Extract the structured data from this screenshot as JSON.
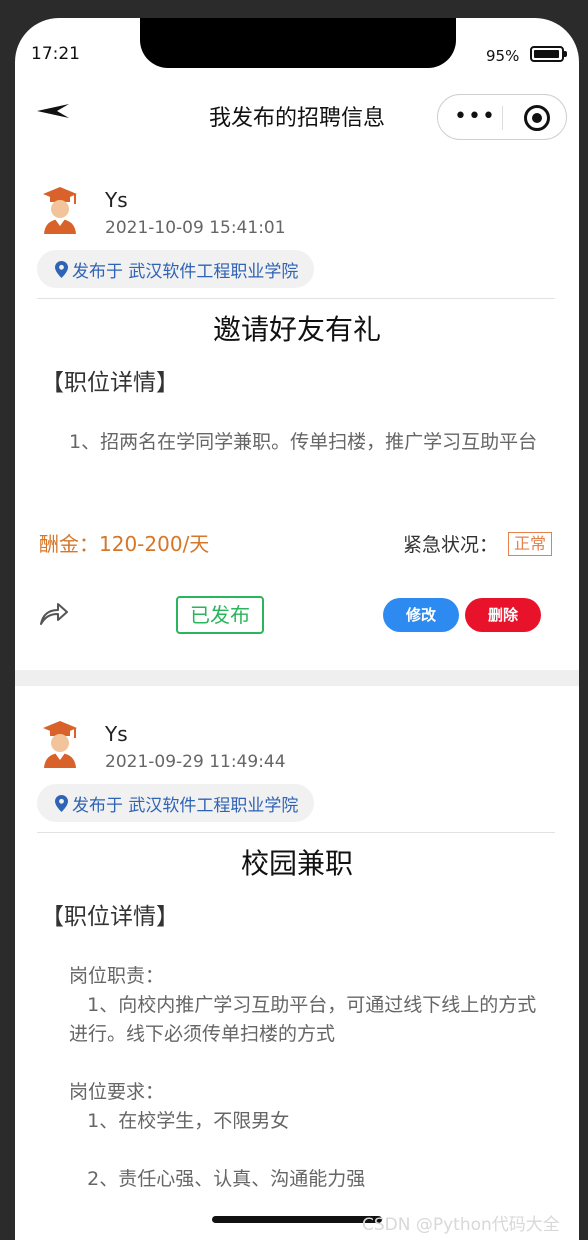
{
  "status_bar": {
    "time": "17:21",
    "battery_pct": "95%",
    "battery_level": 0.95
  },
  "nav": {
    "back_icon": "back-arrow-icon",
    "title": "我发布的招聘信息",
    "menu_icon": "more-dots-icon",
    "close_icon": "target-icon"
  },
  "posts": [
    {
      "user": "Ys",
      "datetime": "2021-10-09 15:41:01",
      "location": "发布于 武汉软件工程职业学院",
      "title": "邀请好友有礼",
      "detail_heading": "【职位详情】",
      "detail_body": "1、招两名在学同学兼职。传单扫楼，推广学习互助平台",
      "pay": "酬金：120-200/天",
      "urgency_label": "紧急状况：",
      "urgency": "正常",
      "status": "已发布",
      "edit": "修改",
      "delete": "删除"
    },
    {
      "user": "Ys",
      "datetime": "2021-09-29 11:49:44",
      "location": "发布于 武汉软件工程职业学院",
      "title": "校园兼职",
      "detail_heading": "【职位详情】",
      "detail_body": "岗位职责：\n   1、向校内推广学习互助平台，可通过线下线上的方式进行。线下必须传单扫楼的方式\n\n岗位要求：\n   1、在校学生，不限男女\n\n   2、责任心强、认真、沟通能力强"
    }
  ],
  "watermark": "CSDN @Python代码大全",
  "colors": {
    "pay": "#d67628",
    "location": "#2f63b5",
    "published": "#2ab45b",
    "edit": "#2d8af0",
    "delete": "#e8132b"
  }
}
